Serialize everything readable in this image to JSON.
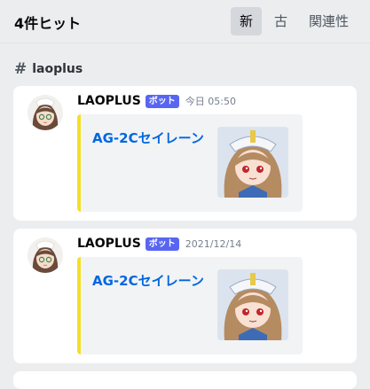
{
  "header": {
    "result_count": "4件ヒット",
    "sort_tabs": [
      {
        "label": "新",
        "active": true
      },
      {
        "label": "古",
        "active": false
      },
      {
        "label": "関連性",
        "active": false
      }
    ]
  },
  "channel": {
    "name": "laoplus",
    "icon": "hash-icon"
  },
  "results": [
    {
      "author": "LAOPLUS",
      "bot_tag": "ボット",
      "timestamp": "今日 05:50",
      "embed": {
        "title": "AG-2Cセイレーン",
        "accent_color": "#f4df29"
      }
    },
    {
      "author": "LAOPLUS",
      "bot_tag": "ボット",
      "timestamp": "2021/12/14",
      "embed": {
        "title": "AG-2Cセイレーン",
        "accent_color": "#f4df29"
      }
    }
  ],
  "colors": {
    "background": "#ebedef",
    "card": "#ffffff",
    "bot_tag": "#5865f2",
    "link": "#0067e0"
  }
}
